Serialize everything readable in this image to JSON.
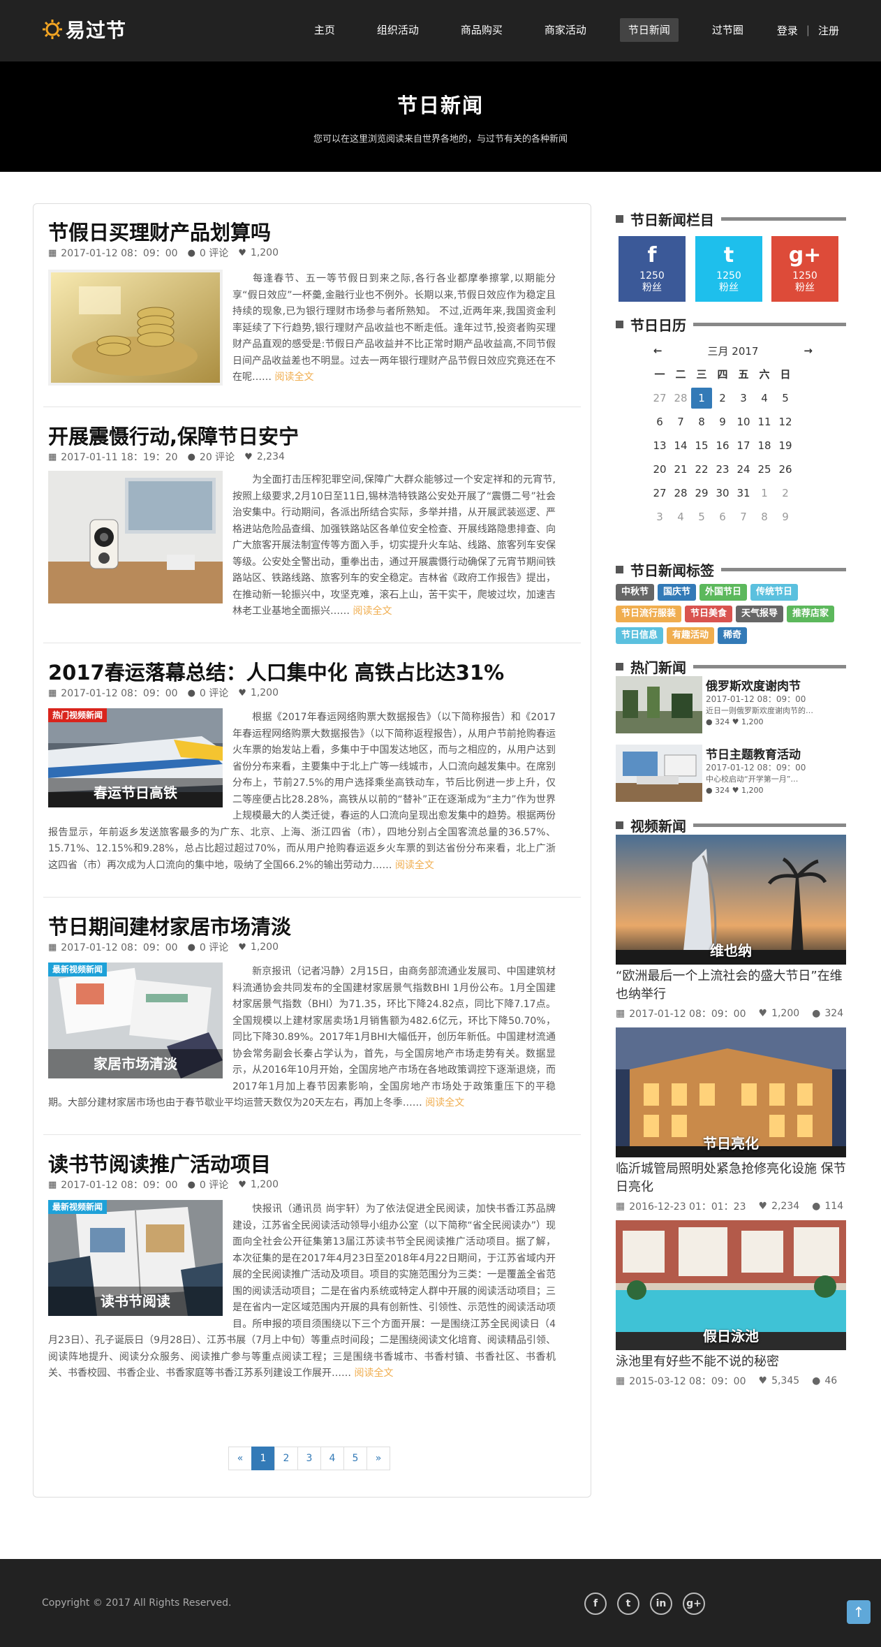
{
  "header": {
    "logo": "易过节",
    "nav": [
      "主页",
      "组织活动",
      "商品购买",
      "商家活动",
      "节日新闻",
      "过节圈"
    ],
    "active_nav": "节日新闻",
    "login": "登录",
    "register": "注册"
  },
  "banner": {
    "title": "节日新闻",
    "subtitle": "您可以在这里浏览阅读来自世界各地的，与过节有关的各种新闻"
  },
  "posts": [
    {
      "title": "节假日买理财产品划算吗",
      "date": "2017-01-12 08：09：00",
      "comments": "0 评论",
      "likes": "1,200",
      "thumb_tag": "",
      "thumb_caption": "",
      "body": "每逢春节、五一等节假日到来之际,各行各业都摩拳擦掌,以期能分享“假日效应”一杯羹,金融行业也不例外。长期以来,节假日效应作为稳定且持续的现象,已为银行理财市场参与者所熟知。 不过,近两年来,我国资金利率延续了下行趋势,银行理财产品收益也不断走低。逢年过节,投资者购买理财产品直观的感受是:节假日产品收益并不比正常时期产品收益高,不同节假日间产品收益差也不明显。过去一两年银行理财产品节假日效应究竟还在不在呢……",
      "readmore": "阅读全文"
    },
    {
      "title": "开展震慑行动,保障节日安宁",
      "date": "2017-01-11 18：19：20",
      "comments": "20 评论",
      "likes": "2,234",
      "thumb_tag": "",
      "thumb_caption": "",
      "body": "为全面打击压榨犯罪空间,保障广大群众能够过一个安定祥和的元宵节,按照上级要求,2月10日至11日,锡林浩特铁路公安处开展了“震慑二号”社会治安集中。行动期间，各派出所结合实际，多举并措，从开展武装巡逻、严格进站危险品查缉、加强铁路站区各单位安全检查、开展线路隐患排查、向广大旅客开展法制宣传等方面入手，切实提升火车站、线路、旅客列车安保等级。公安处全警出动，重拳出击，通过开展震慑行动确保了元宵节期间铁路站区、铁路线路、旅客列车的安全稳定。吉林省《政府工作报告》提出，在推动新一轮振兴中，攻坚克难，滚石上山，苦干实干，爬坡过坎，加速吉林老工业基地全面振兴……",
      "readmore": "阅读全文"
    },
    {
      "title": "2017春运落幕总结：人口集中化 高铁占比达31%",
      "date": "2017-01-12 08：09：00",
      "comments": "0 评论",
      "likes": "1,200",
      "thumb_tag": "热门视频新闻",
      "thumb_caption": "春运节日高铁",
      "body": "根据《2017年春运网络购票大数据报告》（以下简称报告）和《2017年春运程网络购票大数据报告》（以下简称返程报告），从用户节前抢购春运火车票的始发站上看，多集中于中国发达地区，而与之相应的，从用户达到省份分布来看，主要集中于北上广等一线城市，人口流向越发集中。在席别分布上，节前27.5%的用户选择乘坐高铁动车，节后比例进一步上升，仅二等座便占比28.28%，高铁从以前的“替补”正在逐渐成为“主力”作为世界上规模最大的人类迁徙，春运的人口流向呈现出愈发集中的趋势。根据两份报告显示，年前返乡发送旅客最多的为广东、北京、上海、浙江四省（市），四地分别占全国客流总量的36.57%、15.71%、12.15%和9.28%，总占比超过超过70%，而从用户抢购春运返乡火车票的到达省份分布来看，北上广浙这四省（市）再次成为人口流向的集中地，吸纳了全国66.2%的输出劳动力……",
      "readmore": "阅读全文"
    },
    {
      "title": "节日期间建材家居市场清淡",
      "date": "2017-01-12 08：09：00",
      "comments": "0 评论",
      "likes": "1,200",
      "thumb_tag": "最新视频新闻",
      "thumb_caption": "家居市场清淡",
      "body": "新京报讯（记者冯静）2月15日，由商务部流通业发展司、中国建筑材料流通协会共同发布的全国建材家居景气指数BHI 1月份公布。1月全国建材家居景气指数（BHI）为71.35，环比下降24.82点，同比下降7.17点。全国规模以上建材家居卖场1月销售额为482.6亿元，环比下降50.70%，同比下降30.89%。2017年1月BHI大幅低开，创历年新低。中国建材流通协会常务副会长秦占学认为，首先，与全国房地产市场走势有关。数据显示，从2016年10月开始，全国房地产市场在各地政策调控下逐渐退烧，而2017年1月加上春节因素影响，全国房地产市场处于政策重压下的平稳期。大部分建材家居市场也由于春节歇业平均运营天数仅为20天左右，再加上冬季……",
      "readmore": "阅读全文"
    },
    {
      "title": "读书节阅读推广活动项目",
      "date": "2017-01-12 08：09：00",
      "comments": "0 评论",
      "likes": "1,200",
      "thumb_tag": "最新视频新闻",
      "thumb_caption": "读书节阅读",
      "body": "快报讯（通讯员 尚宇轩）为了依法促进全民阅读，加快书香江苏品牌建设，江苏省全民阅读活动领导小组办公室（以下简称“省全民阅读办”）现面向全社会公开征集第13届江苏读书节全民阅读推广活动项目。据了解，本次征集的是在2017年4月23日至2018年4月22日期间，于江苏省域内开展的全民阅读推广活动及项目。项目的实施范围分为三类：一是覆盖全省范围的阅读活动项目；二是在省内系统或特定人群中开展的阅读活动项目；三是在省内一定区域范围内开展的具有创新性、引领性、示范性的阅读活动项目。所申报的项目须围绕以下三个方面开展：一是围绕江苏全民阅读日（4月23日）、孔子诞辰日（9月28日）、江苏书展（7月上中旬）等重点时间段；二是围绕阅读文化培育、阅读精品引领、阅读阵地提升、阅读分众服务、阅读推广参与等重点阅读工程；三是围绕书香城市、书香村镇、书香社区、书香机关、书香校园、书香企业、书香家庭等书香江苏系列建设工作展开……",
      "readmore": "阅读全文"
    }
  ],
  "pagination": [
    "«",
    "1",
    "2",
    "3",
    "4",
    "5",
    "»"
  ],
  "pagination_active": "1",
  "sidebar": {
    "column_title": "节日新闻栏目",
    "social": [
      {
        "icon": "facebook-icon",
        "glyph": "f",
        "count": "1250",
        "label": "粉丝",
        "color": "#3b5998"
      },
      {
        "icon": "twitter-icon",
        "glyph": "t",
        "count": "1250",
        "label": "粉丝",
        "color": "#1ebfec"
      },
      {
        "icon": "google-plus-icon",
        "glyph": "g+",
        "count": "1250",
        "label": "粉丝",
        "color": "#dd4b39"
      }
    ],
    "calendar_title": "节日日历",
    "calendar": {
      "month": "三月 2017",
      "prev": "←",
      "next": "→",
      "weekdays": [
        "一",
        "二",
        "三",
        "四",
        "五",
        "六",
        "日"
      ],
      "days": [
        "27",
        "28",
        "1",
        "2",
        "3",
        "4",
        "5",
        "6",
        "7",
        "8",
        "9",
        "10",
        "11",
        "12",
        "13",
        "14",
        "15",
        "16",
        "17",
        "18",
        "19",
        "20",
        "21",
        "22",
        "23",
        "24",
        "25",
        "26",
        "27",
        "28",
        "29",
        "30",
        "31",
        "1",
        "2",
        "3",
        "4",
        "5",
        "6",
        "7",
        "8",
        "9"
      ],
      "today": "1"
    },
    "tags_title": "节日新闻标签",
    "tags": [
      {
        "label": "中秋节",
        "color": "#666"
      },
      {
        "label": "国庆节",
        "color": "#337ab7"
      },
      {
        "label": "外国节日",
        "color": "#5cb85c"
      },
      {
        "label": "传统节日",
        "color": "#5bc0de"
      },
      {
        "label": "节日流行服装",
        "color": "#f0ad4e"
      },
      {
        "label": "节日美食",
        "color": "#d9534f"
      },
      {
        "label": "天气报导",
        "color": "#666"
      },
      {
        "label": "推荐店家",
        "color": "#5cb85c"
      },
      {
        "label": "节日信息",
        "color": "#5bc0de"
      },
      {
        "label": "有趣活动",
        "color": "#f0ad4e"
      },
      {
        "label": "稀奇",
        "color": "#337ab7"
      }
    ],
    "hot_title": "热门新闻",
    "hot": [
      {
        "title": "俄罗斯欢度谢肉节",
        "date": "2017-01-12 08：09：00",
        "excerpt": "近日一则俄罗斯欢度谢肉节的…",
        "likes": "324",
        "hearts": "1,200"
      },
      {
        "title": "节日主题教育活动",
        "date": "2017-01-12 08：09：00",
        "excerpt": "中心校启动“开学第一月”…",
        "likes": "324",
        "hearts": "1,200"
      }
    ],
    "video_title": "视频新闻",
    "videos": [
      {
        "caption": "维也纳",
        "title": "“欧洲最后一个上流社会的盛大节日”在维也纳举行",
        "date": "2017-01-12 08：09：00",
        "likes": "1,200",
        "comments": "324"
      },
      {
        "caption": "节日亮化",
        "title": "临沂城管局照明处紧急抢修亮化设施 保节日亮化",
        "date": "2016-12-23 01：01：23",
        "likes": "2,234",
        "comments": "114"
      },
      {
        "caption": "假日泳池",
        "title": "泳池里有好些不能不说的秘密",
        "date": "2015-03-12 08：09：00",
        "likes": "5,345",
        "comments": "46"
      }
    ]
  },
  "footer": {
    "copyright": "Copyright © 2017 All Rights Reserved.",
    "social": [
      "facebook-icon",
      "twitter-icon",
      "linkedin-icon",
      "google-plus-icon"
    ],
    "social_glyphs": [
      "f",
      "t",
      "in",
      "g+"
    ],
    "back_to_top": "↑"
  },
  "icons": {
    "calendar": "calendar-icon",
    "comment": "comment-icon",
    "heart": "heart-icon"
  }
}
